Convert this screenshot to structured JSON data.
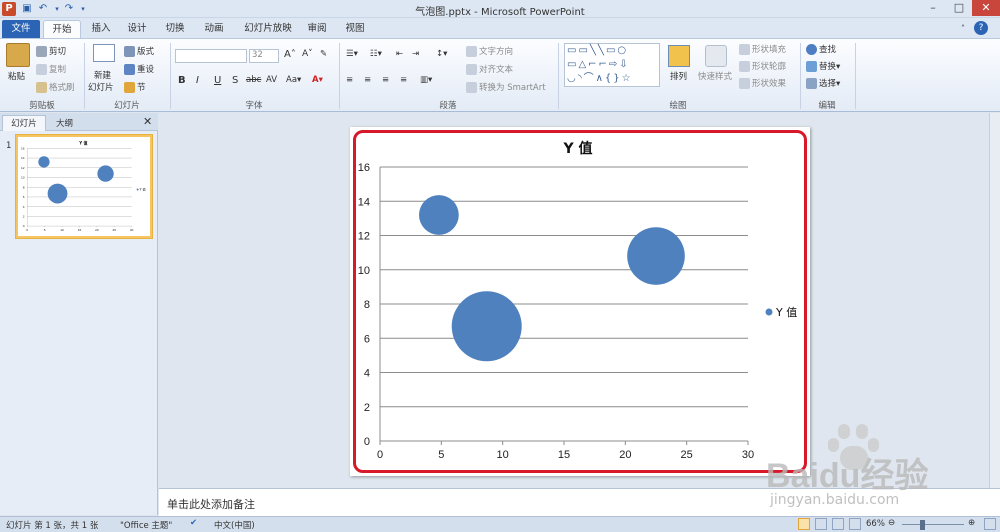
{
  "window": {
    "title": "气泡图.pptx - Microsoft PowerPoint"
  },
  "tabs": [
    {
      "label": "文件"
    },
    {
      "label": "开始"
    },
    {
      "label": "插入"
    },
    {
      "label": "设计"
    },
    {
      "label": "切换"
    },
    {
      "label": "动画"
    },
    {
      "label": "幻灯片放映"
    },
    {
      "label": "审阅"
    },
    {
      "label": "视图"
    }
  ],
  "ribbon": {
    "clipboard": {
      "paste": "粘贴",
      "cut": "剪切",
      "copy": "复制",
      "format_painter": "格式刷",
      "group": "剪贴板"
    },
    "slides": {
      "new_slide_1": "新建",
      "new_slide_2": "幻灯片",
      "layout": "版式",
      "reset": "重设",
      "section": "节",
      "group": "幻灯片"
    },
    "font": {
      "font_size": "32",
      "group": "字体"
    },
    "paragraph": {
      "text_direction": "文字方向",
      "align_text": "对齐文本",
      "convert_smartart": "转换为 SmartArt",
      "group": "段落"
    },
    "drawing": {
      "arrange": "排列",
      "quick_styles": "快速样式",
      "shape_fill": "形状填充",
      "shape_outline": "形状轮廓",
      "shape_effects": "形状效果",
      "group": "绘图"
    },
    "editing": {
      "find": "查找",
      "replace": "替换",
      "select": "选择",
      "group": "编辑"
    }
  },
  "left_pane": {
    "tab_slides": "幻灯片",
    "tab_outline": "大纲",
    "slide_number": "1"
  },
  "notes": {
    "placeholder": "单击此处添加备注"
  },
  "status": {
    "slide": "幻灯片 第 1 张，共 1 张",
    "theme": "\"Office 主题\"",
    "language": "中文(中国)",
    "zoom": "66%"
  },
  "watermark": {
    "brand": "Baidu经验",
    "url": "jingyan.baidu.com"
  },
  "colors": {
    "bubble": "#4e81bd",
    "frame": "#d7192a",
    "file_tab": "#2b64b5"
  },
  "chart_data": {
    "type": "bubble",
    "title": "Y 值",
    "xlim": [
      0,
      30
    ],
    "ylim": [
      0,
      16
    ],
    "x_ticks": [
      "0",
      "5",
      "10",
      "15",
      "20",
      "25",
      "30"
    ],
    "y_ticks": [
      "0",
      "2",
      "4",
      "6",
      "8",
      "10",
      "12",
      "14",
      "16"
    ],
    "grid": "horizontal",
    "legend_position": "right",
    "series": [
      {
        "name": "Y 值",
        "points": [
          {
            "x": 4.8,
            "y": 13.2,
            "size": 1
          },
          {
            "x": 8.7,
            "y": 6.7,
            "size": 3.1
          },
          {
            "x": 22.5,
            "y": 10.8,
            "size": 2.1
          }
        ]
      }
    ]
  }
}
